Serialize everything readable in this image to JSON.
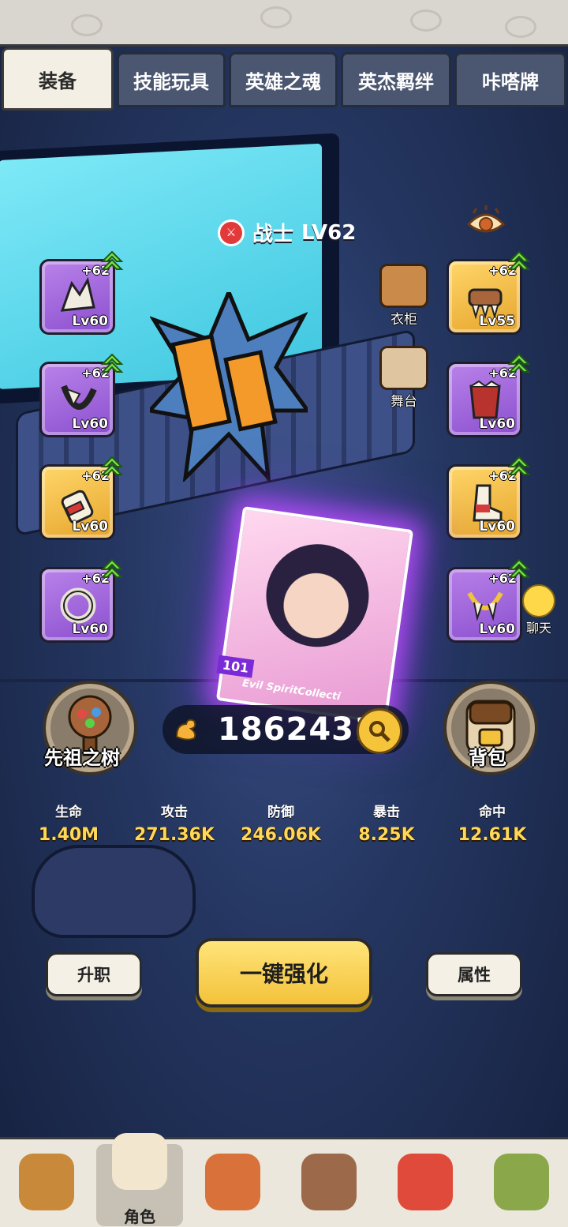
{
  "tabs": [
    "装备",
    "技能玩具",
    "英雄之魂",
    "英杰羁绊",
    "咔嗒牌"
  ],
  "hero": {
    "class_name": "战士",
    "level": "LV62"
  },
  "slots_left": [
    {
      "plus": "+62",
      "level": "Lv60",
      "rarity": "purple",
      "icon": "bone-helmet-icon"
    },
    {
      "plus": "+62",
      "level": "Lv60",
      "rarity": "purple",
      "icon": "fang-necklace-icon"
    },
    {
      "plus": "+62",
      "level": "Lv60",
      "rarity": "gold",
      "icon": "gauntlet-icon"
    },
    {
      "plus": "+62",
      "level": "Lv60",
      "rarity": "purple",
      "icon": "stone-ring-icon"
    }
  ],
  "slots_right": [
    {
      "plus": "+62",
      "level": "Lv55",
      "rarity": "gold",
      "icon": "claw-weapon-icon"
    },
    {
      "plus": "+62",
      "level": "Lv60",
      "rarity": "purple",
      "icon": "tribal-armor-icon"
    },
    {
      "plus": "+62",
      "level": "Lv60",
      "rarity": "gold",
      "icon": "boots-icon"
    },
    {
      "plus": "+62",
      "level": "Lv60",
      "rarity": "purple",
      "icon": "tooth-amulet-icon"
    }
  ],
  "side": {
    "wardrobe": "衣柜",
    "stage": "舞台"
  },
  "card": {
    "number": "101",
    "tag": "Evil SpiritCollecti"
  },
  "power": "1862431",
  "round_buttons": {
    "tree": "先祖之树",
    "bag": "背包"
  },
  "stats": [
    {
      "name": "生命",
      "value": "1.40M"
    },
    {
      "name": "攻击",
      "value": "271.36K"
    },
    {
      "name": "防御",
      "value": "246.06K"
    },
    {
      "name": "暴击",
      "value": "8.25K"
    },
    {
      "name": "命中",
      "value": "12.61K"
    }
  ],
  "buttons": {
    "promote": "升职",
    "upgrade_all": "一键强化",
    "attributes": "属性"
  },
  "chat": "聊天",
  "bottom_nav": [
    {
      "label": "",
      "icon": "caveman-hero-icon"
    },
    {
      "label": "角色",
      "icon": "character-hero-icon"
    },
    {
      "label": "",
      "icon": "feather-hero-icon"
    },
    {
      "label": "",
      "icon": "bearded-hero-icon"
    },
    {
      "label": "",
      "icon": "dino-hero-icon"
    },
    {
      "label": "",
      "icon": "tiki-hero-icon"
    }
  ],
  "colors": {
    "accent_gold": "#f3c23a",
    "epic_purple": "#8b4fcf",
    "stat_yellow": "#ffd85a"
  }
}
